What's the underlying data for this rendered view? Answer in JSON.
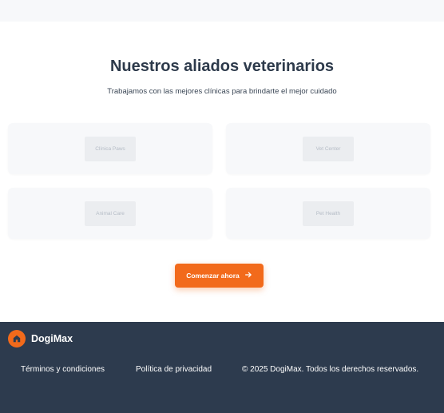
{
  "section": {
    "title": "Nuestros aliados veterinarios",
    "subtitle": "Trabajamos con las mejores clínicas para brindarte el mejor cuidado",
    "partners": [
      {
        "name": "Clínica Paws"
      },
      {
        "name": "Vet Center"
      },
      {
        "name": "Animal Care"
      },
      {
        "name": "Pet Health"
      }
    ],
    "cta_label": "Comenzar ahora",
    "cta_icon": "arrow-right-icon"
  },
  "footer": {
    "brand_name": "DogiMax",
    "brand_icon": "house-icon",
    "links": [
      {
        "label": "Términos y condiciones"
      },
      {
        "label": "Política de privacidad"
      }
    ],
    "copyright": "© 2025 DogiMax. Todos los derechos reservados."
  },
  "colors": {
    "accent": "#f26a1b",
    "footer_bg": "#2d3b4e",
    "heading": "#2d3a4b",
    "card_bg": "#f7f8fa"
  }
}
